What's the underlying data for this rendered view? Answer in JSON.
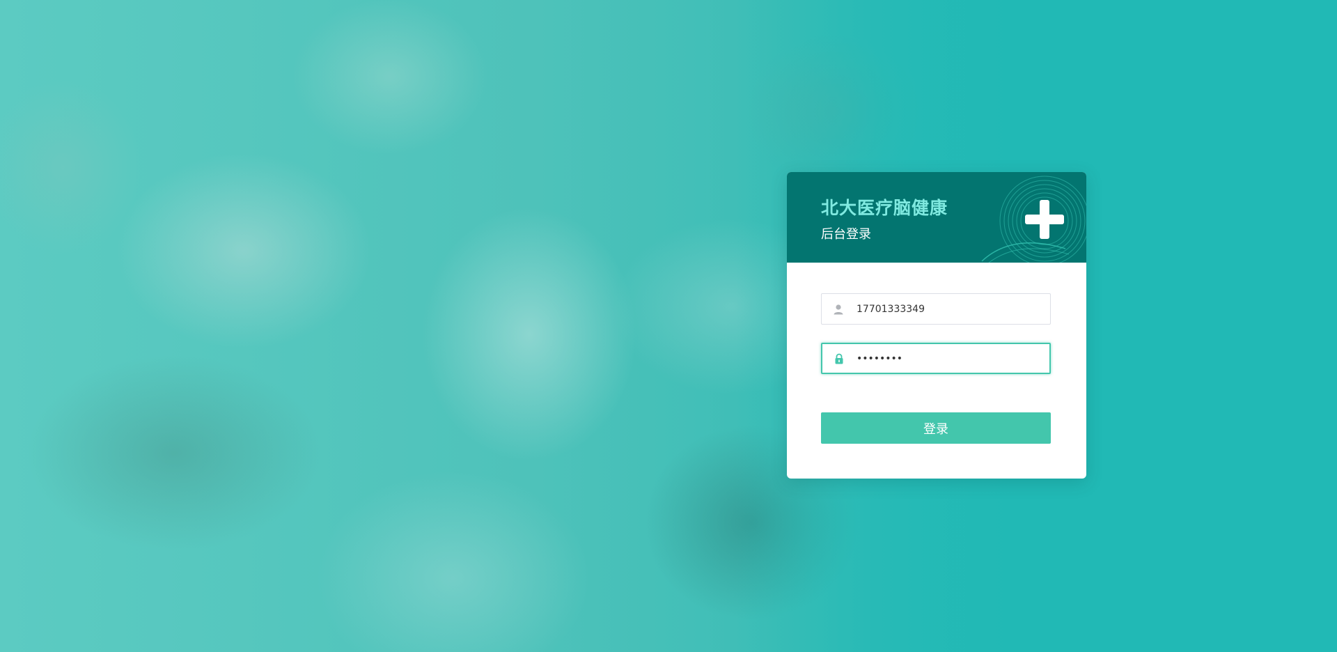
{
  "login": {
    "title": "北大医疗脑健康",
    "subtitle": "后台登录",
    "username_value": "17701333349",
    "password_value": "••••••••",
    "submit_label": "登录"
  },
  "colors": {
    "background": "#22bab6",
    "header": "#037570",
    "title": "#7fe9e0",
    "accent": "#43c6ac"
  },
  "icons": {
    "header": "medical-cross-icon",
    "username": "user-icon",
    "password": "lock-icon"
  }
}
